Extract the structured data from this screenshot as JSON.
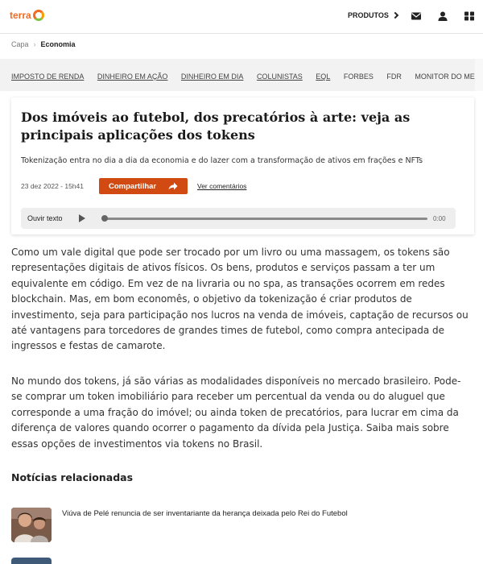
{
  "header": {
    "logo_text": "terra",
    "products_label": "PRODUTOS",
    "icons": [
      "mail-icon",
      "user-icon",
      "grid-icon"
    ]
  },
  "breadcrumb": {
    "home": "Capa",
    "separator": "›",
    "current": "Economia"
  },
  "nav": {
    "items": [
      "IMPOSTO DE RENDA",
      "DINHEIRO EM AÇÃO",
      "DINHEIRO EM DIA",
      "COLUNISTAS",
      "EQL",
      "FORBES",
      "FDR",
      "MONITOR DO MERCADO"
    ]
  },
  "article": {
    "title": "Dos imóveis ao futebol, dos precatórios à arte: veja as principais aplicações dos tokens",
    "subtitle": "Tokenização entra no dia a dia da economia e do lazer com a transformação de ativos em frações e NFTs",
    "date": "23 dez 2022 - 15h41",
    "share_label": "Compartilhar",
    "comments_label": "Ver comentários",
    "player": {
      "label": "Ouvir texto",
      "time": "0:00",
      "progress": 0
    },
    "paragraphs": [
      "Como um vale digital que pode ser trocado por um livro ou uma massagem, os tokens são representações digitais de ativos físicos. Os bens, produtos e serviços passam a ter um equivalente em código. Em vez de na livraria ou no spa, as transações ocorrem em redes blockchain. Mas, em bom economês, o objetivo da tokenização é criar produtos de investimento, seja para participação nos lucros na venda de imóveis, captação de recursos ou até vantagens para torcedores de grandes times de futebol, como compra antecipada de ingressos e festas de camarote.",
      "No mundo dos tokens, já são várias as modalidades disponíveis no mercado brasileiro. Pode-se comprar um token imobiliário para receber um percentual da venda ou do aluguel que corresponde a uma fração do imóvel; ou ainda token de precatórios, para lucrar em cima da diferença de valores quando ocorrer o pagamento da dívida pela Justiça. Saiba mais sobre essas opções de investimentos via tokens no Brasil."
    ]
  },
  "related": {
    "heading": "Notícias relacionadas",
    "items": [
      {
        "title": "Viúva de Pelé renuncia de ser inventariante da herança deixada pelo Rei do Futebol"
      }
    ]
  },
  "colors": {
    "brand_orange": "#f26b21",
    "share_button": "#d04a12"
  }
}
